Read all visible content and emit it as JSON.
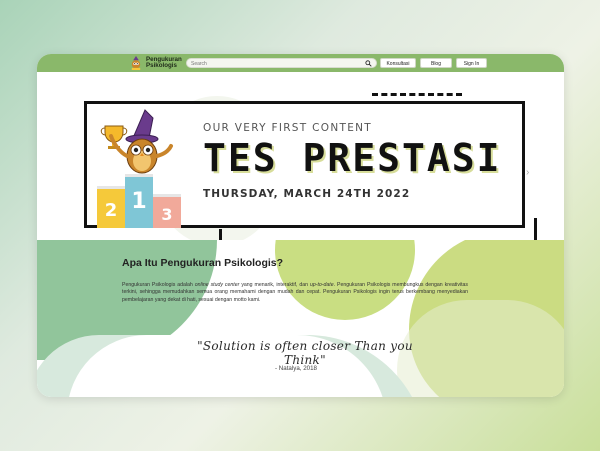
{
  "brand": {
    "name_line1": "Pengukuran",
    "name_line2": "Psikologis"
  },
  "search": {
    "placeholder": "Search",
    "icon": "search-icon"
  },
  "nav": {
    "buttons": [
      {
        "label": "Konsultasi"
      },
      {
        "label": "Blog"
      },
      {
        "label": "Sign In"
      }
    ]
  },
  "hero": {
    "eyebrow": "OUR VERY FIRST CONTENT",
    "title": "TES PRESTASI",
    "date": "THURSDAY, MARCH 24TH 2022",
    "podium": {
      "first": "1",
      "second": "2",
      "third": "3"
    }
  },
  "content": {
    "title": "Apa Itu Pengukuran Psikologis?",
    "paragraph_parts": [
      "Pengukuran Psikologis adalah ",
      "online study center",
      " yang menarik, interaktif, dan ",
      "up-to-date",
      ". Pengukuran Psikologis membungkus dengan kreativitas terkini, sehingga memudahkan semua orang memahami dengan mudah dan cepat. Pengukuran Psikologis ingin terus berkembang menyediakan pembelajaran yang dekat di hati, sesuai dengan motto kami."
    ]
  },
  "quote": {
    "text": "\"Solution is often closer Than you Think\"",
    "author": "- Natalya, 2018"
  },
  "colors": {
    "nav_green": "#8ab86a",
    "podium_yellow": "#f5c93a",
    "podium_blue": "#7fc6d6",
    "podium_pink": "#f1a99a",
    "accent_lime": "#c9de82",
    "accent_green": "#91c59b"
  }
}
